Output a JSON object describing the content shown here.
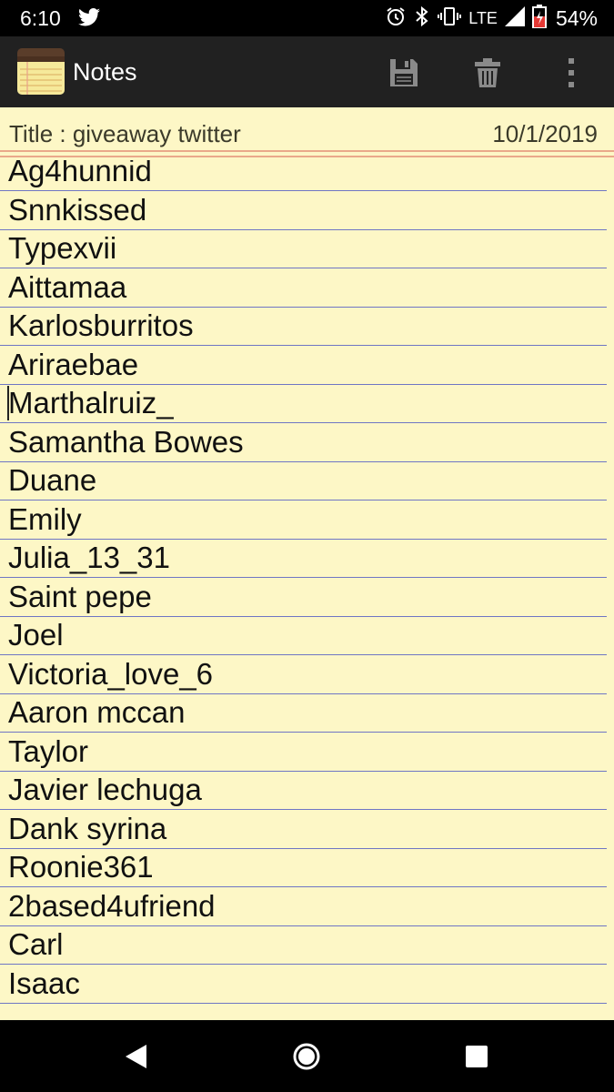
{
  "status_bar": {
    "time": "6:10",
    "network": "LTE",
    "battery": "54%",
    "icons": [
      "twitter-icon",
      "alarm-icon",
      "bluetooth-icon",
      "vibrate-icon",
      "signal-icon",
      "battery-icon"
    ]
  },
  "app_bar": {
    "title": "Notes",
    "actions": [
      "save-icon",
      "delete-icon",
      "more-icon"
    ]
  },
  "note": {
    "title": "Title : giveaway twitter",
    "date": "10/1/2019",
    "lines": [
      "Ag4hunnid",
      "Snnkissed",
      "Typexvii",
      "Aittamaa",
      "Karlosburritos",
      "Ariraebae",
      "Marthalruiz_",
      "Samantha Bowes",
      "Duane",
      "Emily",
      "Julia_13_31",
      "Saint pepe",
      "Joel",
      "Victoria_love_6",
      "Aaron mccan",
      "Taylor",
      "Javier lechuga",
      "Dank syrina",
      "Roonie361",
      "2based4ufriend",
      "Carl",
      "Isaac"
    ],
    "cursor_line": 6
  },
  "colors": {
    "paper": "#fdf7c6",
    "rule": "#6f76c4",
    "title_rule": "#eaa98a",
    "app_bar": "#212121"
  },
  "nav_bar": [
    "back-icon",
    "home-icon",
    "recents-icon"
  ]
}
